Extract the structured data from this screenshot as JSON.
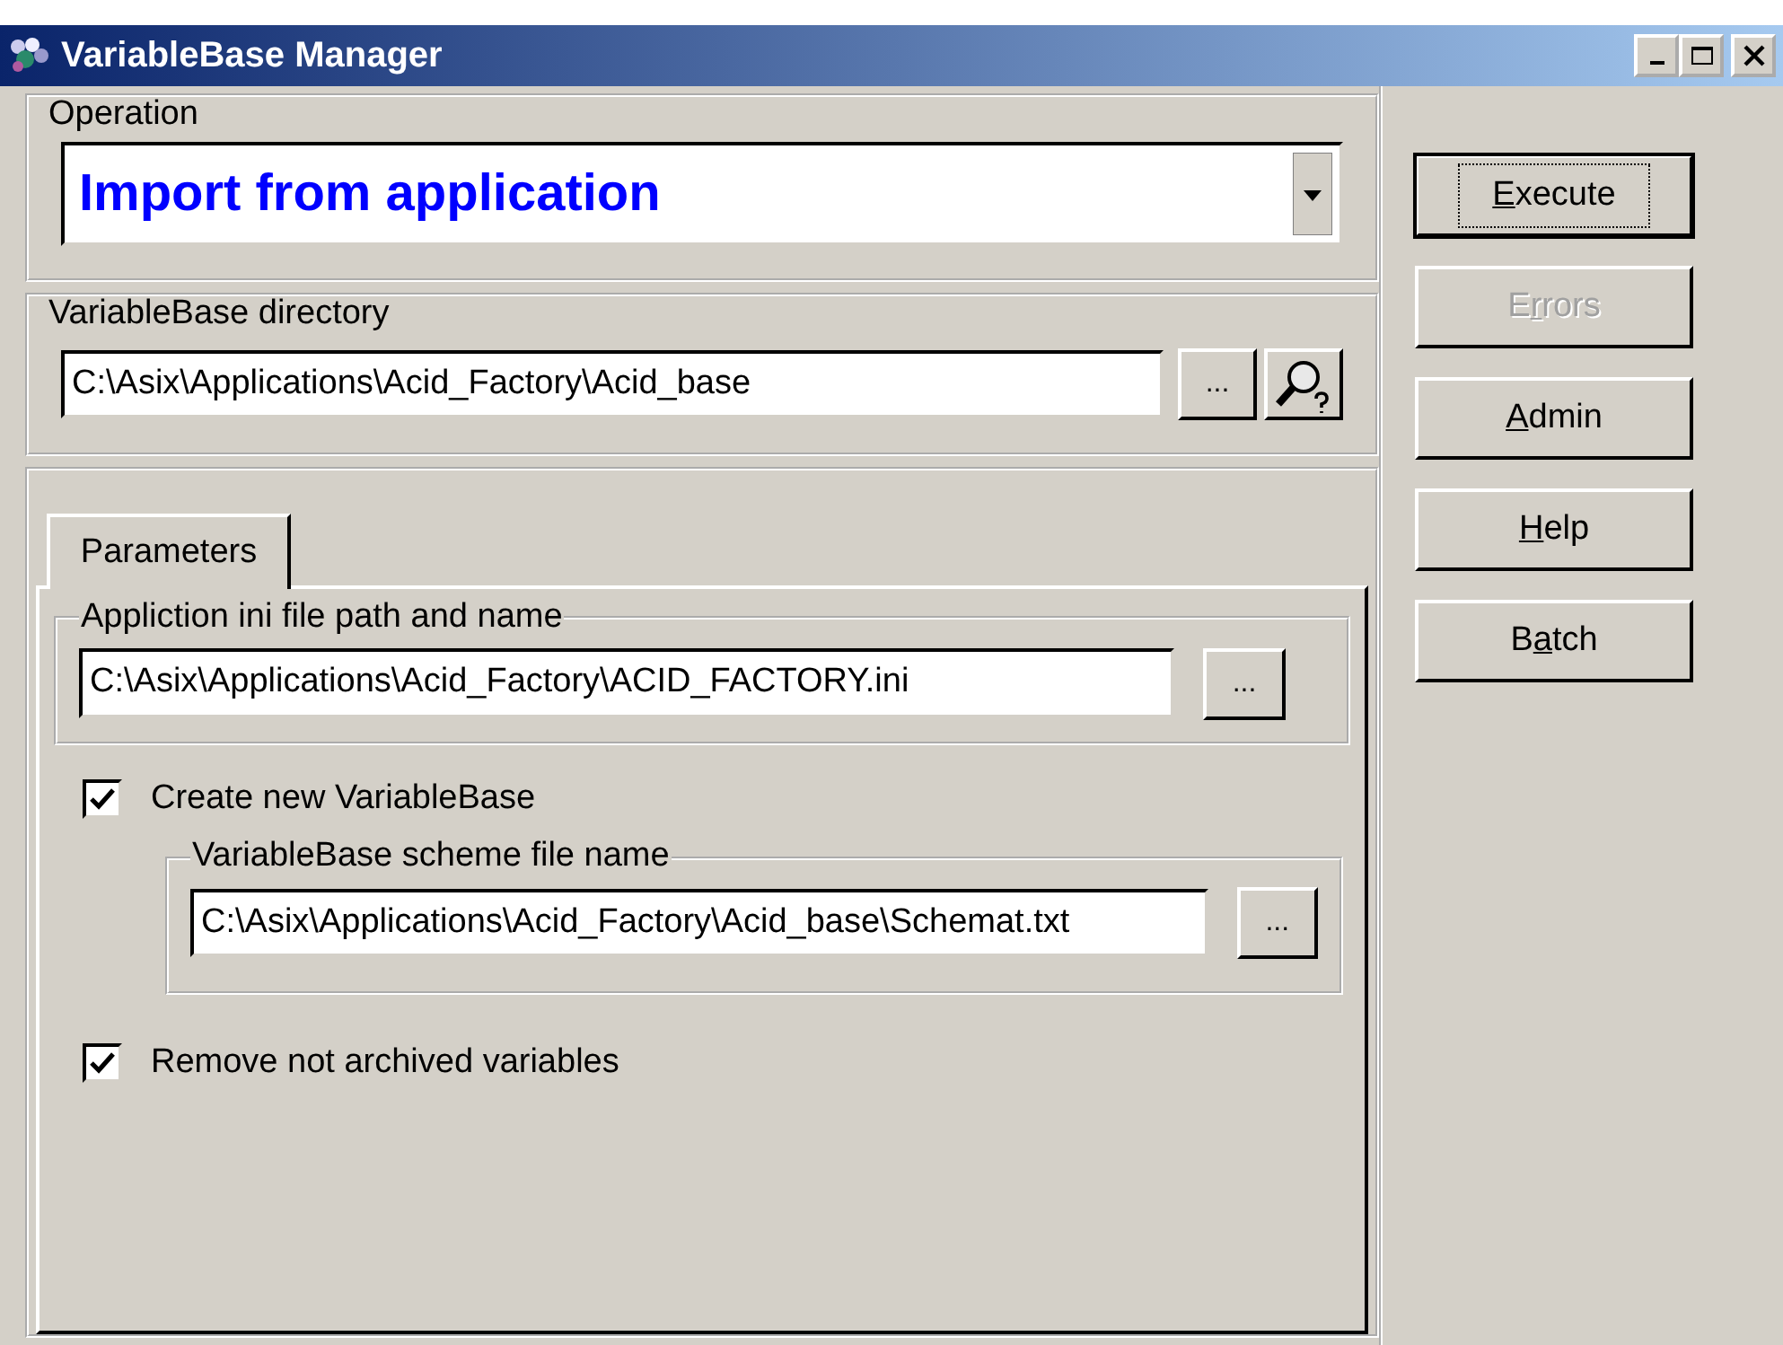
{
  "window": {
    "title": "VariableBase Manager"
  },
  "operation": {
    "label": "Operation",
    "value": "Import from application"
  },
  "directory": {
    "label": "VariableBase directory",
    "value": "C:\\Asix\\Applications\\Acid_Factory\\Acid_base",
    "browse_button": "..."
  },
  "tabs": [
    {
      "label": "Parameters",
      "selected": true
    }
  ],
  "app_ini": {
    "label": "Appliction ini file path and name",
    "value": "C:\\Asix\\Applications\\Acid_Factory\\ACID_FACTORY.ini",
    "browse_button": "..."
  },
  "create_new": {
    "label": "Create new VariableBase",
    "checked": true
  },
  "scheme": {
    "label": "VariableBase scheme file name",
    "value": "C:\\Asix\\Applications\\Acid_Factory\\Acid_base\\Schemat.txt",
    "browse_button": "..."
  },
  "remove_unarchived": {
    "label": "Remove not archived variables",
    "checked": true
  },
  "buttons": [
    {
      "label": [
        {
          "text": "E",
          "underline": true
        },
        {
          "text": "xecute",
          "underline": false
        }
      ],
      "default": true,
      "disabled": false
    },
    {
      "label": [
        {
          "text": "E",
          "underline": false
        },
        {
          "text": "r",
          "underline": true
        },
        {
          "text": "rors",
          "underline": false
        }
      ],
      "default": false,
      "disabled": true
    },
    {
      "label": [
        {
          "text": "A",
          "underline": true
        },
        {
          "text": "dmin",
          "underline": false
        }
      ],
      "default": false,
      "disabled": false
    },
    {
      "label": [
        {
          "text": "H",
          "underline": true
        },
        {
          "text": "elp",
          "underline": false
        }
      ],
      "default": false,
      "disabled": false
    },
    {
      "label": [
        {
          "text": "B",
          "underline": false
        },
        {
          "text": "a",
          "underline": true
        },
        {
          "text": "tch",
          "underline": false
        }
      ],
      "default": false,
      "disabled": false
    }
  ]
}
